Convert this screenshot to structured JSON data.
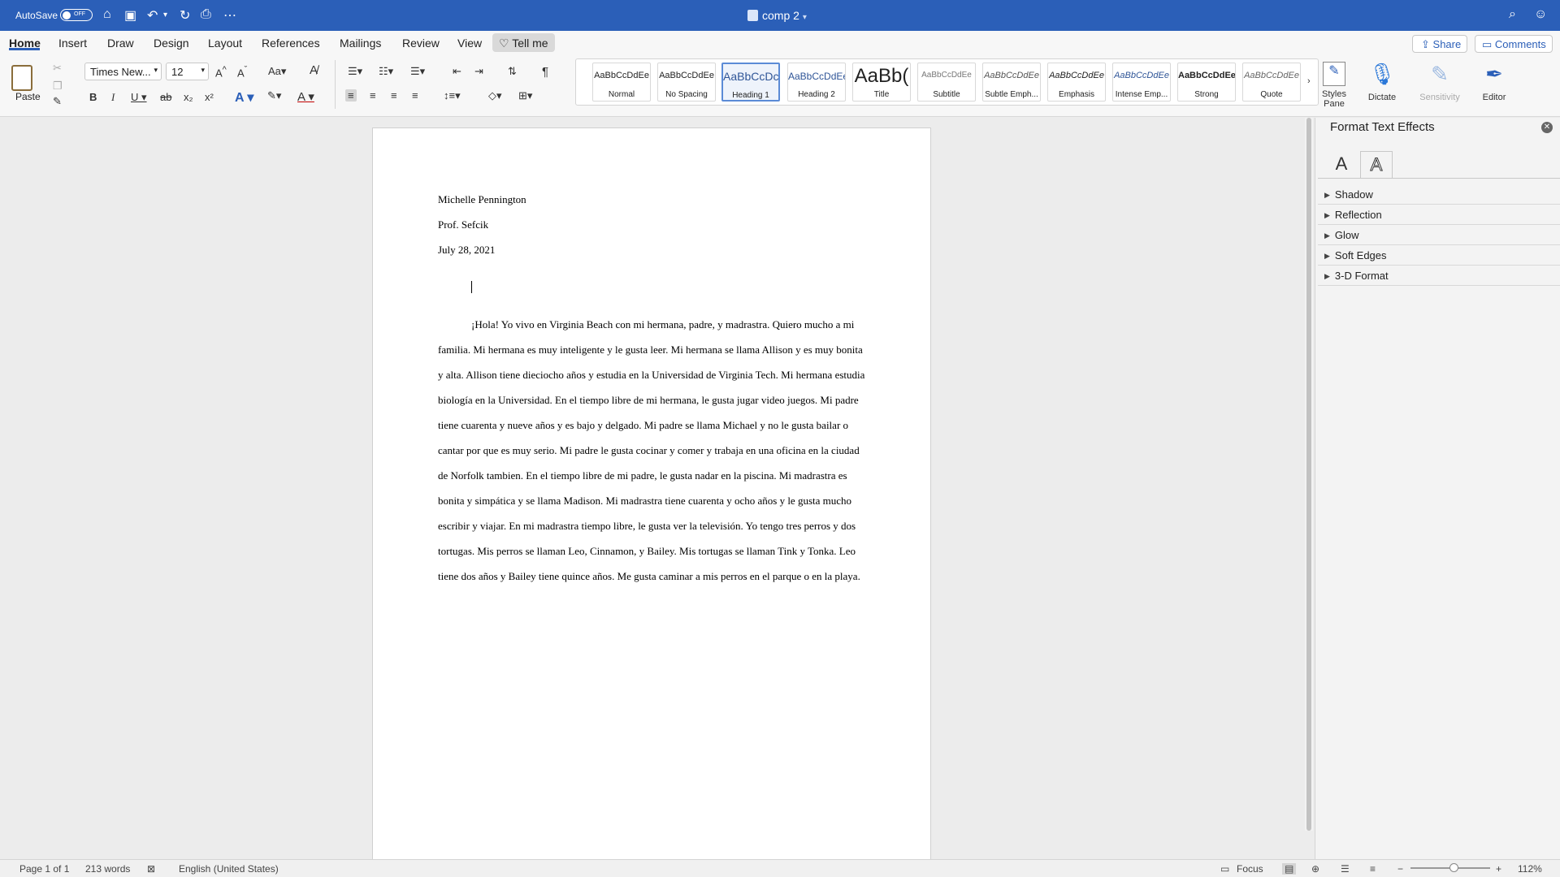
{
  "titlebar": {
    "autosave_label": "AutoSave",
    "autosave_state": "OFF",
    "doc_title": "comp 2",
    "icons": [
      "home-icon",
      "save-icon",
      "undo-icon",
      "redo-icon",
      "print-icon",
      "more-icon",
      "search-icon",
      "smiley-icon"
    ]
  },
  "tabs": [
    "Home",
    "Insert",
    "Draw",
    "Design",
    "Layout",
    "References",
    "Mailings",
    "Review",
    "View"
  ],
  "tell_me": "Tell me",
  "share_label": "Share",
  "comments_label": "Comments",
  "ribbon": {
    "paste_label": "Paste",
    "font_name": "Times New...",
    "font_size": "12",
    "styles": [
      {
        "preview": "AaBbCcDdEe",
        "name": "Normal"
      },
      {
        "preview": "AaBbCcDdEe",
        "name": "No Spacing"
      },
      {
        "preview": "AaBbCcDc",
        "name": "Heading 1"
      },
      {
        "preview": "AaBbCcDdEe",
        "name": "Heading 2"
      },
      {
        "preview": "AaBb(",
        "name": "Title"
      },
      {
        "preview": "AaBbCcDdEe",
        "name": "Subtitle"
      },
      {
        "preview": "AaBbCcDdEe",
        "name": "Subtle Emph..."
      },
      {
        "preview": "AaBbCcDdEe",
        "name": "Emphasis"
      },
      {
        "preview": "AaBbCcDdEe",
        "name": "Intense Emp..."
      },
      {
        "preview": "AaBbCcDdEe",
        "name": "Strong"
      },
      {
        "preview": "AaBbCcDdEe",
        "name": "Quote"
      }
    ],
    "styles_pane_label": "Styles Pane",
    "dictate_label": "Dictate",
    "sensitivity_label": "Sensitivity",
    "editor_label": "Editor"
  },
  "document": {
    "name": "Michelle Pennington",
    "professor": "Prof. Sefcik",
    "date": "July 28, 2021",
    "body": "¡Hola! Yo vivo en Virginia Beach con mi hermana, padre, y madrastra. Quiero mucho a mi familia. Mi hermana es muy inteligente y le gusta leer. Mi hermana se llama Allison y es muy bonita y alta. Allison tiene dieciocho años y estudia en la Universidad de Virginia Tech. Mi hermana estudia biología en la Universidad. En el tiempo libre de mi hermana, le gusta jugar video juegos. Mi padre tiene cuarenta y nueve años y es bajo y delgado. Mi padre se llama Michael y no le gusta bailar o cantar por que es muy serio. Mi padre le gusta cocinar y comer y trabaja en una oficina en la ciudad de Norfolk tambien. En el tiempo libre de mi padre, le gusta nadar en la piscina. Mi madrastra es bonita y simpática y se llama Madison. Mi madrastra tiene cuarenta y ocho años y le gusta mucho escribir y viajar. En mi madrastra tiempo libre, le gusta ver la televisión. Yo tengo tres perros y dos tortugas. Mis perros se llaman Leo, Cinnamon, y Bailey. Mis tortugas se llaman Tink y Tonka. Leo tiene dos años y Bailey tiene quince años. Me gusta caminar a mis perros en el parque o en la playa."
  },
  "pane": {
    "title": "Format Text Effects",
    "tab_fill": "A",
    "tab_outline": "A",
    "sections": [
      "Shadow",
      "Reflection",
      "Glow",
      "Soft Edges",
      "3-D Format"
    ]
  },
  "status": {
    "page": "Page 1 of 1",
    "words": "213 words",
    "language": "English (United States)",
    "focus": "Focus",
    "zoom": "112%",
    "zoom_fraction": 0.55
  },
  "colors": {
    "titlebar": "#2b5fb8",
    "accent": "#2b5fb8"
  }
}
